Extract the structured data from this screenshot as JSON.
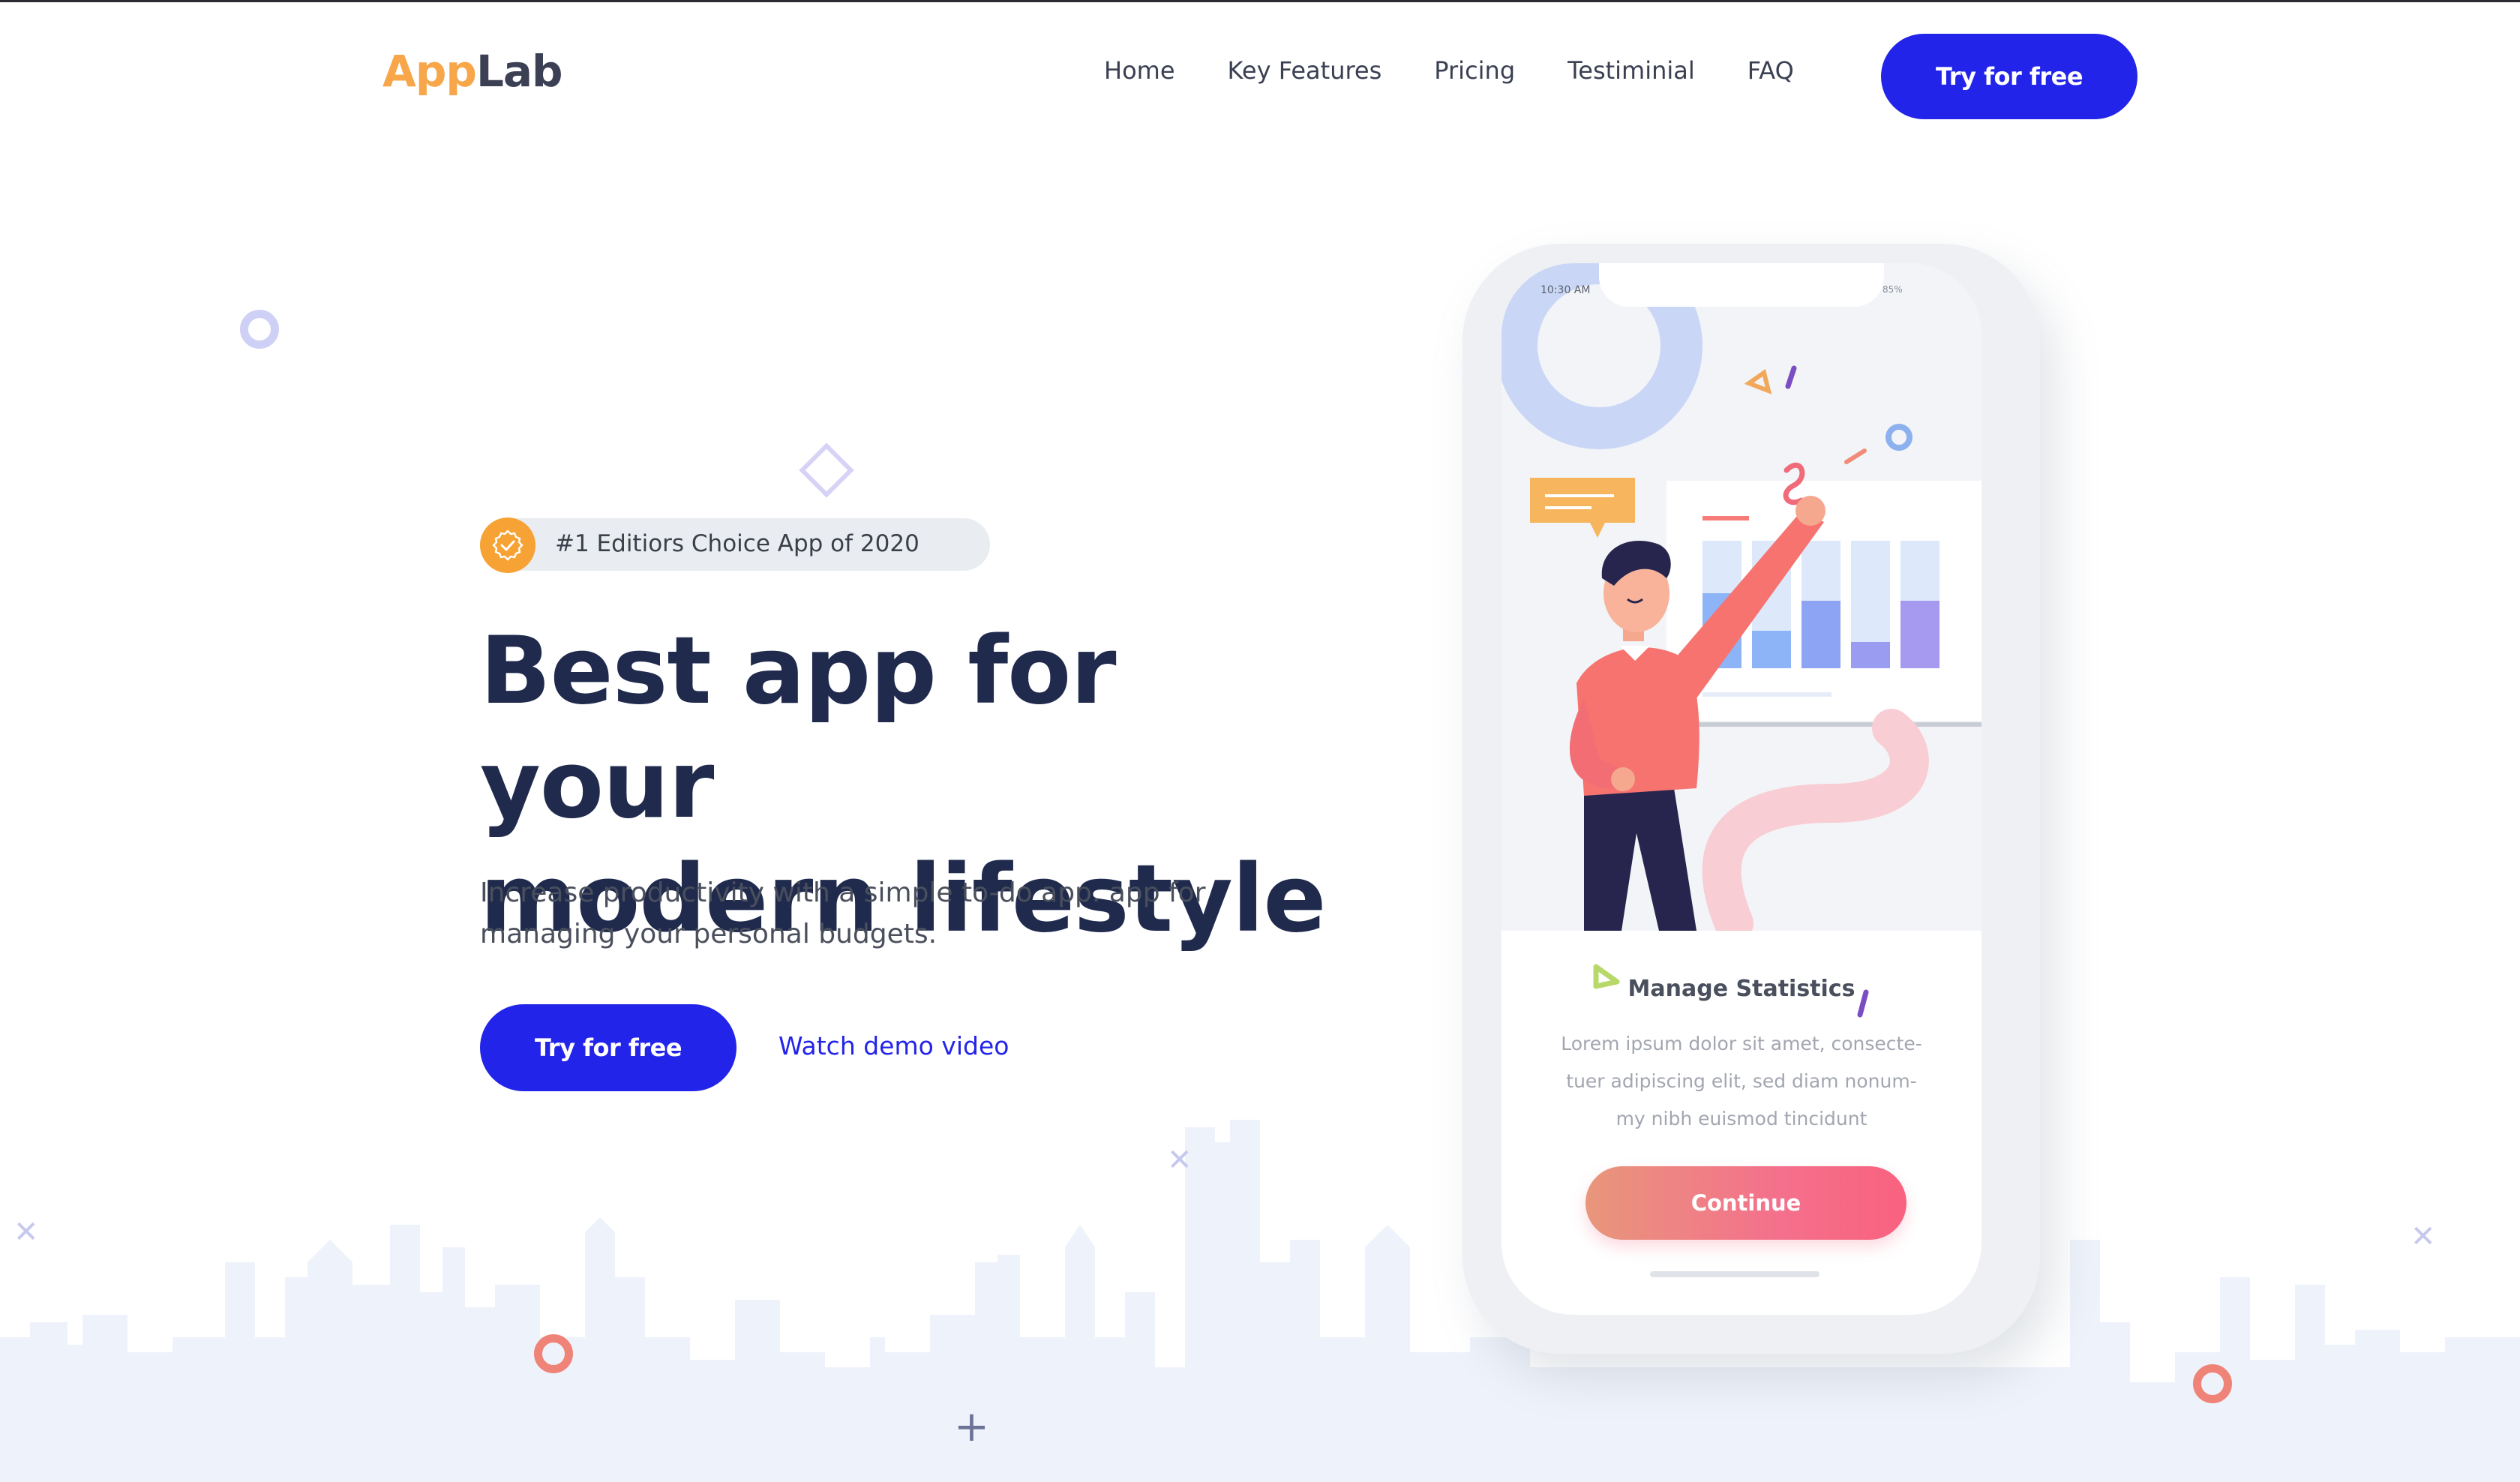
{
  "brand": {
    "part1": "App",
    "part2": "Lab"
  },
  "nav": {
    "items": [
      "Home",
      "Key Features",
      "Pricing",
      "Testiminial",
      "FAQ"
    ],
    "cta_label": "Try for free"
  },
  "hero": {
    "badge_text": "#1 Editiors Choice App of 2020",
    "headline_line1": "Best app for your",
    "headline_line2": "modern lifestyle",
    "subtext_line1": "Increase productivity with a simple to-do app. app for",
    "subtext_line2": "managing your personal budgets.",
    "cta_label": "Try for free",
    "demo_label": "Watch demo video"
  },
  "phone": {
    "status_time": "10:30 AM",
    "status_battery": "85%",
    "card_title": "Manage Statistics",
    "card_body_line1": "Lorem ipsum dolor sit amet, consecte-",
    "card_body_line2": "tuer adipiscing elit, sed diam nonum-",
    "card_body_line3": "my nibh euismod tincidunt",
    "continue_label": "Continue"
  },
  "colors": {
    "primary": "#2324e9",
    "headline": "#1f2a4d",
    "logo_orange": "#f7a64a",
    "badge_orange": "#f6a234",
    "skyline": "#edf1f9"
  }
}
